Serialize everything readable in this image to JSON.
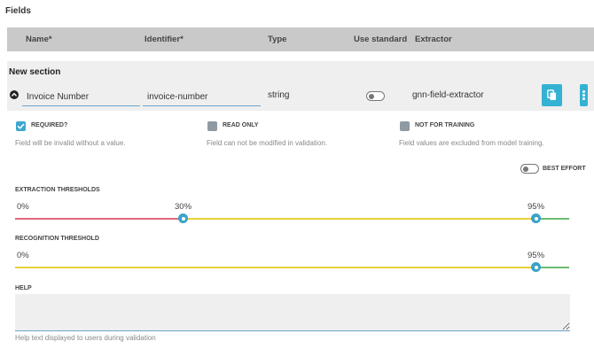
{
  "page": {
    "title": "Fields"
  },
  "columns": {
    "name": "Name*",
    "identifier": "Identifier*",
    "type": "Type",
    "use_standard": "Use standard",
    "extractor": "Extractor"
  },
  "section": {
    "title": "New section"
  },
  "field": {
    "name": "Invoice Number",
    "identifier": "invoice-number",
    "type": "string",
    "use_standard": false,
    "extractor": "gnn-field-extractor"
  },
  "options": {
    "required": {
      "label": "REQUIRED?",
      "description": "Field will be invalid without a value.",
      "checked": true
    },
    "read_only": {
      "label": "READ ONLY",
      "description": "Field can not be modified in validation.",
      "checked": false
    },
    "not_for_training": {
      "label": "NOT FOR TRAINING",
      "description": "Field values are excluded from model training.",
      "checked": false
    },
    "best_effort": {
      "label": "BEST EFFORT",
      "enabled": false
    }
  },
  "extraction_thresholds": {
    "label": "EXTRACTION THRESHOLDS",
    "min_label": "0%",
    "low_label": "30%",
    "high_label": "95%",
    "low_value": 30,
    "high_value": 95
  },
  "recognition_threshold": {
    "label": "RECOGNITION THRESHOLD",
    "min_label": "0%",
    "high_label": "95%",
    "high_value": 95
  },
  "help": {
    "label": "HELP",
    "value": "",
    "description": "Help text displayed to users during validation"
  },
  "colors": {
    "accent": "#34b2d3",
    "handle": "#3aa3c9",
    "danger_line": "#e5677a",
    "warning_line": "#e8d13a",
    "success_line": "#6cbd74",
    "checkbox_checked": "#3ea7cf",
    "checkbox_unchecked": "#8f9aa3"
  },
  "icons": {
    "field_expand": "chevron-up-icon",
    "copy": "copy-icon",
    "more": "more-vertical-icon",
    "check": "check-icon"
  }
}
